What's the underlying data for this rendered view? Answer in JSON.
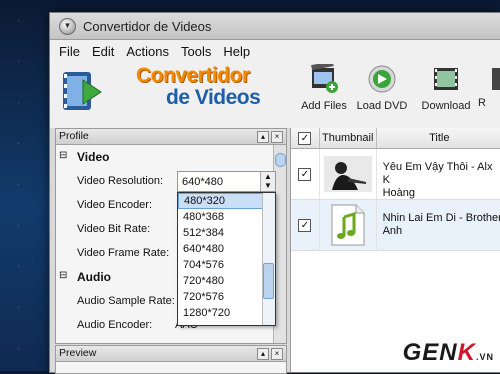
{
  "window": {
    "title": "Convertidor de Videos"
  },
  "menu": [
    "File",
    "Edit",
    "Actions",
    "Tools",
    "Help"
  ],
  "logo": {
    "line1": "Convertidor",
    "line2": "de Videos"
  },
  "toolbar": [
    {
      "label": "Add Files",
      "icon": "film-plus-icon"
    },
    {
      "label": "Load DVD",
      "icon": "green-arrow-icon"
    },
    {
      "label": "Download",
      "icon": "film-download-icon"
    },
    {
      "label": "R",
      "icon": "partial-icon"
    }
  ],
  "profile": {
    "title": "Profile",
    "video_group": "Video",
    "audio_group": "Audio",
    "rows": [
      {
        "label": "Video Resolution:",
        "value": "640*480"
      },
      {
        "label": "Video Encoder:",
        "value": ""
      },
      {
        "label": "Video Bit Rate:",
        "value": ""
      },
      {
        "label": "Video Frame Rate:",
        "value": ""
      },
      {
        "label": "Audio Sample Rate:",
        "value": ""
      },
      {
        "label": "Audio Encoder:",
        "value": "AAC"
      }
    ],
    "resolution_options": [
      "480*320",
      "480*368",
      "512*384",
      "640*480",
      "704*576",
      "720*480",
      "720*576",
      "1280*720"
    ],
    "selected_option_index": 0
  },
  "preview": {
    "title": "Preview"
  },
  "file_list": {
    "columns": [
      "",
      "Thumbnail",
      "Title"
    ],
    "rows": [
      {
        "checked": true,
        "title_line1": "Yêu Em Vậy Thôi - Alx K",
        "title_line2": "Hoàng",
        "thumb": "video-thumbnail"
      },
      {
        "checked": true,
        "title_line1": "Nhin Lai Em Di - Brother",
        "title_line2": "Anh",
        "thumb": "music-note-icon"
      }
    ]
  },
  "watermark": {
    "g": "GEN",
    "k": "K",
    "vn": ".VN"
  },
  "colors": {
    "logo_orange": "#f08a00",
    "logo_blue": "#1e5ea8",
    "selection": "#c8dff7"
  }
}
